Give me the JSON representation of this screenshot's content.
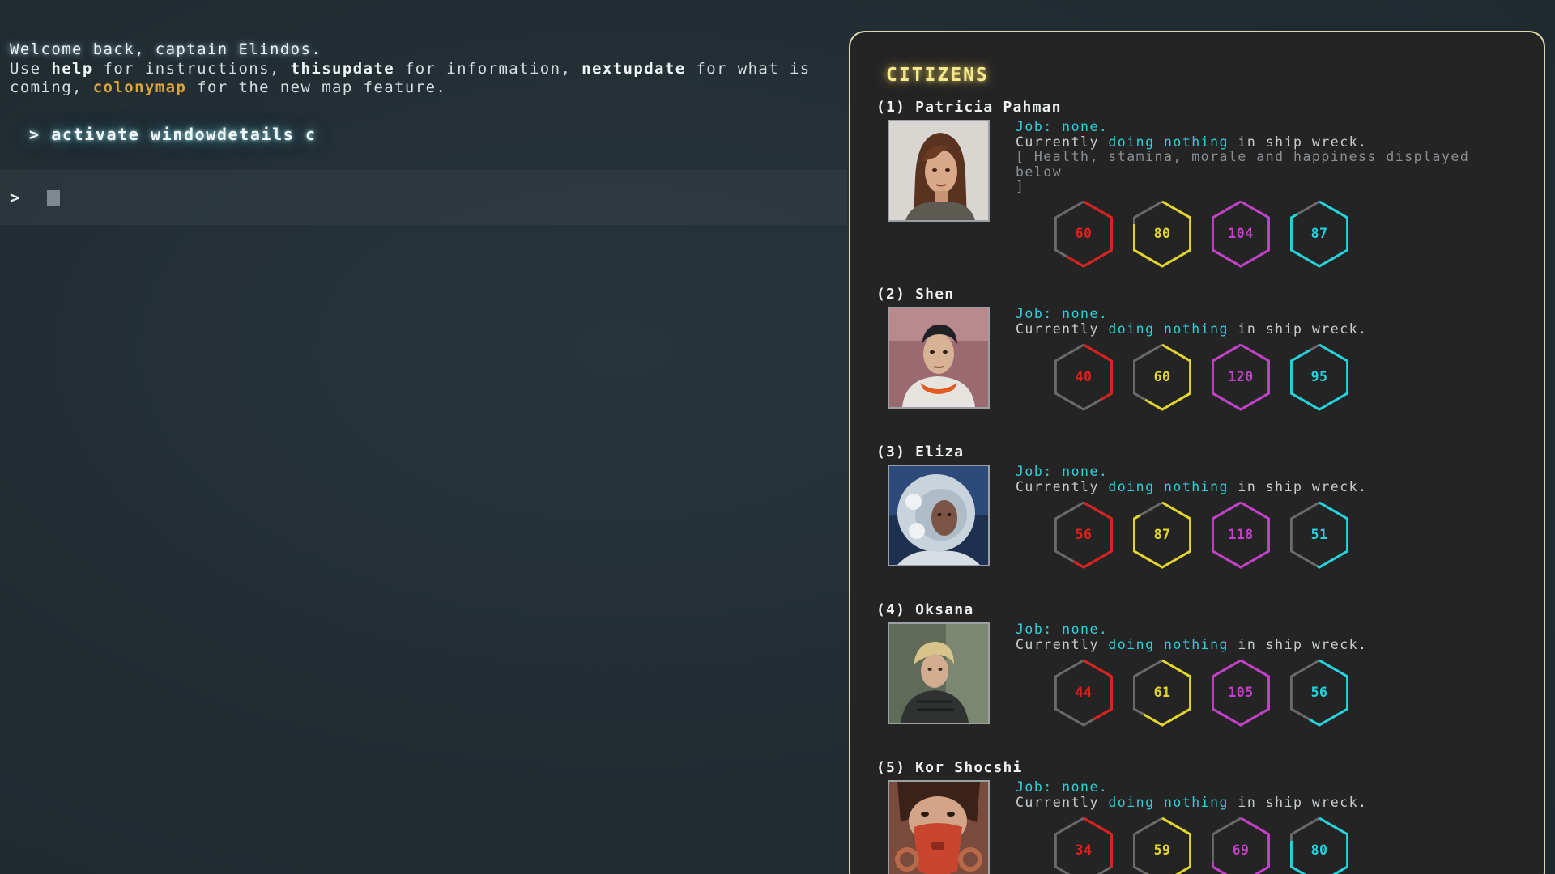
{
  "terminal": {
    "welcome_prefix": "Welcome back, captain Elindos.",
    "line2_use": "Use ",
    "cmd_help": "help",
    "line2_for_instructions": " for instructions, ",
    "cmd_thisupdate": "thisupdate",
    "line2_for_information": " for information, ",
    "cmd_nextupdate": "nextupdate",
    "line2_for_what": " for what is",
    "line3_coming": "coming, ",
    "cmd_colonymap": "colonymap",
    "line3_for_map": " for the new map feature.",
    "history_command": "> activate windowdetails c",
    "prompt_symbol": ">",
    "input_value": ""
  },
  "colors": {
    "health": "#e0201e",
    "stamina": "#e3d629",
    "morale": "#c63fcb",
    "happiness": "#23d3de",
    "track": "#6a6a6a",
    "panel_border": "#ddd8b4",
    "title": "#f5e88e",
    "accent": "#d9a43a"
  },
  "citizens": {
    "title": "CITIZENS",
    "list": [
      {
        "label": "(1) Patricia Pahman",
        "job": "Job: none.",
        "status_prefix": "Currently ",
        "status_activity": "doing nothing",
        "status_suffix": " in ship wreck.",
        "note": "[ Health, stamina, morale and happiness displayed below\n]",
        "portrait_icon": "woman-brown-hair-portrait",
        "stats": {
          "health": 60,
          "stamina": 80,
          "morale": 104,
          "happiness": 87
        }
      },
      {
        "label": "(2) Shen",
        "job": "Job: none.",
        "status_prefix": "Currently ",
        "status_activity": "doing nothing",
        "status_suffix": " in ship wreck.",
        "note": "",
        "portrait_icon": "man-spacesuit-portrait",
        "stats": {
          "health": 40,
          "stamina": 60,
          "morale": 120,
          "happiness": 95
        }
      },
      {
        "label": "(3) Eliza",
        "job": "Job: none.",
        "status_prefix": "Currently ",
        "status_activity": "doing nothing",
        "status_suffix": " in ship wreck.",
        "note": "",
        "portrait_icon": "woman-helmet-portrait",
        "stats": {
          "health": 56,
          "stamina": 87,
          "morale": 118,
          "happiness": 51
        }
      },
      {
        "label": "(4) Oksana",
        "job": "Job: none.",
        "status_prefix": "Currently ",
        "status_activity": "doing nothing",
        "status_suffix": " in ship wreck.",
        "note": "",
        "portrait_icon": "woman-blonde-portrait",
        "stats": {
          "health": 44,
          "stamina": 61,
          "morale": 105,
          "happiness": 56
        }
      },
      {
        "label": "(5) Kor Shocshi",
        "job": "Job: none.",
        "status_prefix": "Currently ",
        "status_activity": "doing nothing",
        "status_suffix": " in ship wreck.",
        "note": "",
        "portrait_icon": "woman-red-mask-portrait",
        "stats": {
          "health": 34,
          "stamina": 59,
          "morale": 69,
          "happiness": 80
        }
      }
    ]
  }
}
